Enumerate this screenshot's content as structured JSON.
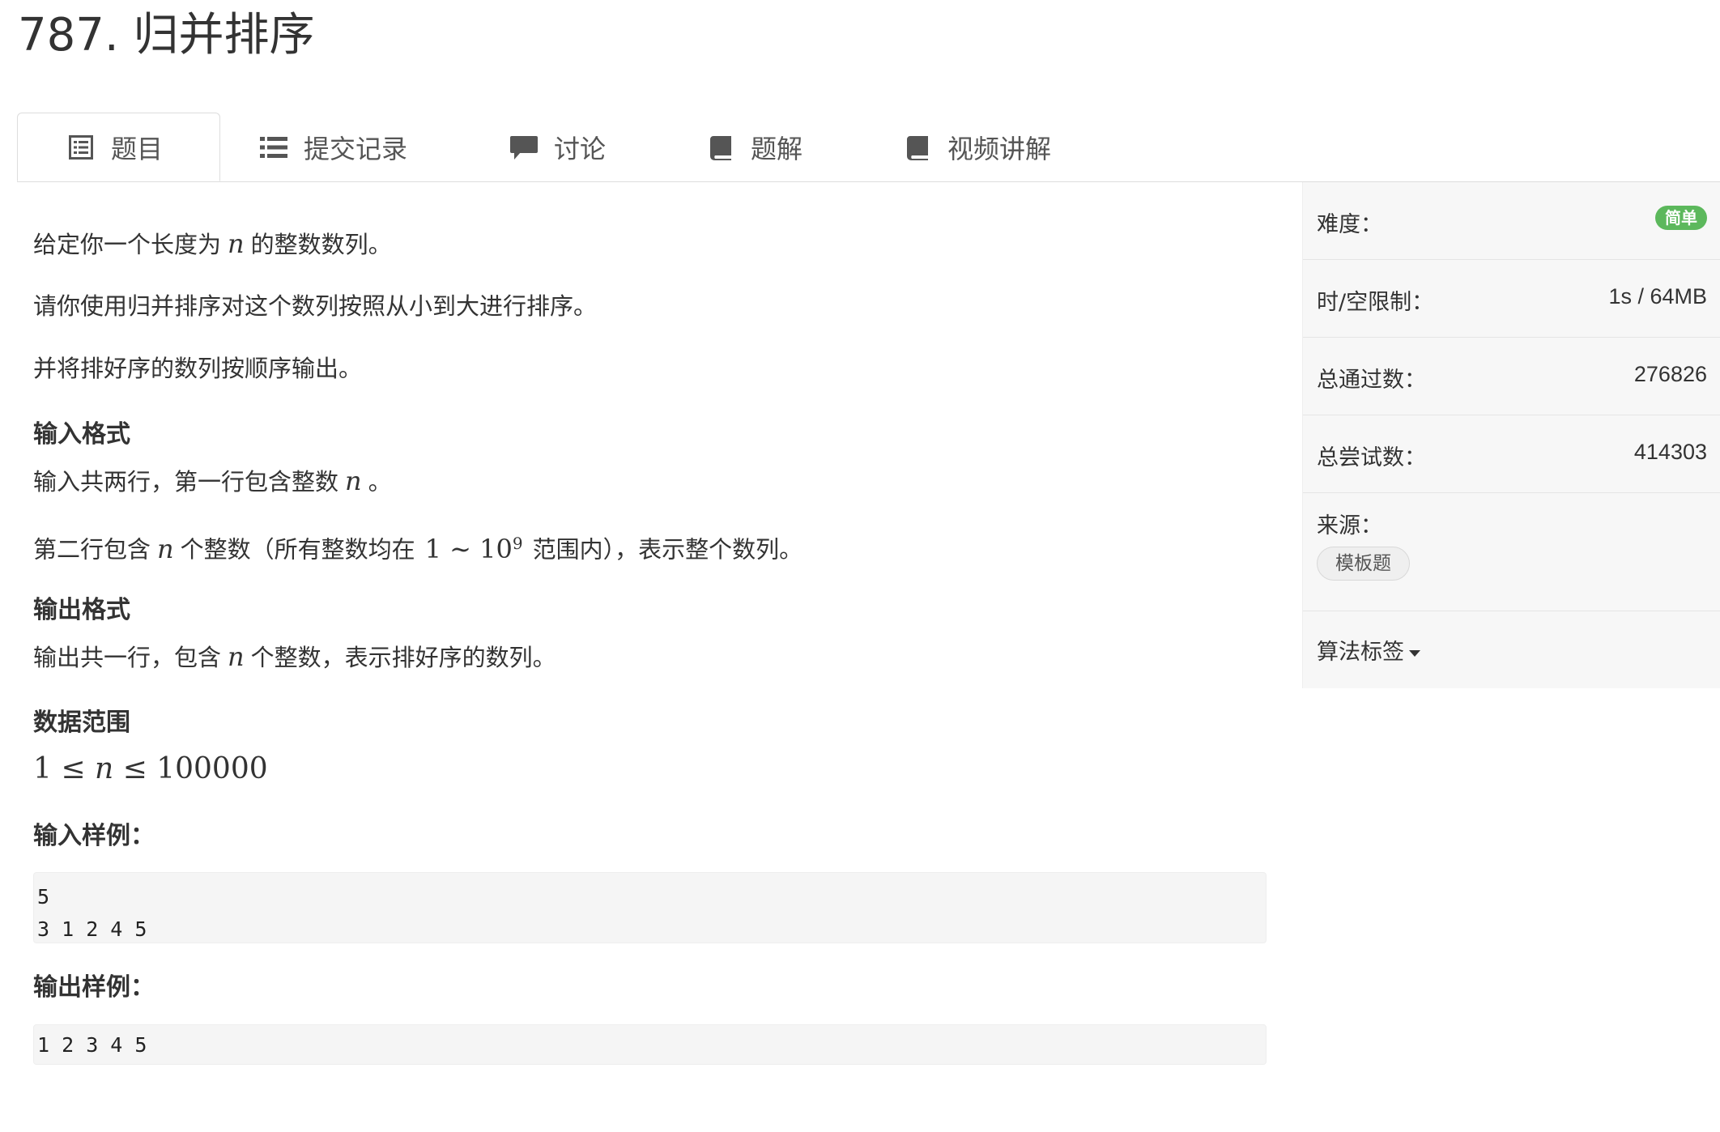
{
  "page": {
    "title": "787. 归并排序"
  },
  "tabs": [
    {
      "label": "题目",
      "icon": "list-alt-icon",
      "active": true
    },
    {
      "label": "提交记录",
      "icon": "list-icon",
      "active": false
    },
    {
      "label": "讨论",
      "icon": "comment-icon",
      "active": false
    },
    {
      "label": "题解",
      "icon": "book-icon",
      "active": false
    },
    {
      "label": "视频讲解",
      "icon": "book-icon",
      "active": false
    }
  ],
  "problem": {
    "p1_before": "给定你一个长度为",
    "p1_var": "n",
    "p1_after": "的整数数列。",
    "p2": "请你使用归并排序对这个数列按照从小到大进行排序。",
    "p3": "并将排好序的数列按顺序输出。",
    "input_format_heading": "输入格式",
    "input_line1_before": "输入共两行，第一行包含整数",
    "input_line1_var": "n",
    "input_line1_after": "。",
    "input_line2_before": "第二行包含",
    "input_line2_var": "n",
    "input_line2_mid": "个整数（所有整数均在",
    "input_line2_math_lo": "1 ∼ 10",
    "input_line2_math_exp": "9",
    "input_line2_after": "范围内），表示整个数列。",
    "output_format_heading": "输出格式",
    "output_line_before": "输出共一行，包含",
    "output_line_var": "n",
    "output_line_after": "个整数，表示排好序的数列。",
    "data_range_heading": "数据范围",
    "data_range_math_1": "1 ≤ ",
    "data_range_math_var": "n",
    "data_range_math_2": " ≤ 100000",
    "sample_input_heading": "输入样例：",
    "sample_input": [
      "5",
      "3 1 2 4 5"
    ],
    "sample_output_heading": "输出样例：",
    "sample_output": [
      "1 2 3 4 5"
    ]
  },
  "sidebar": {
    "difficulty_label": "难度：",
    "difficulty_value": "简单",
    "difficulty_color": "#5cb85c",
    "limit_label": "时/空限制：",
    "limit_value": "1s / 64MB",
    "passed_label": "总通过数：",
    "passed_value": "276826",
    "attempts_label": "总尝试数：",
    "attempts_value": "414303",
    "source_label": "来源：",
    "source_tag": "模板题",
    "algo_tags_label": "算法标签"
  }
}
